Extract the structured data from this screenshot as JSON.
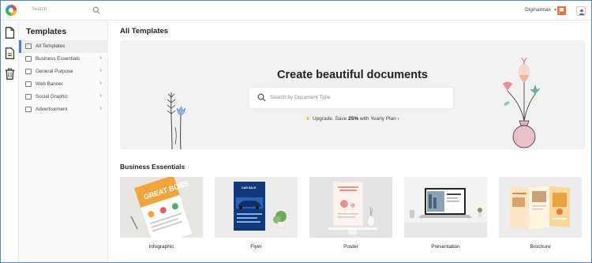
{
  "topbar": {
    "search_placeholder": "Search",
    "user_name": "Digiharmax",
    "accent": "#ee6b3b"
  },
  "rail": {
    "icons": [
      "document-icon",
      "file-text-icon",
      "trash-icon"
    ]
  },
  "sidebar": {
    "title": "Templates",
    "items": [
      {
        "label": "All Templates",
        "icon": "grid-icon",
        "active": true
      },
      {
        "label": "Business Essentials",
        "icon": "briefcase-icon"
      },
      {
        "label": "General Purpose",
        "icon": "layout-icon"
      },
      {
        "label": "Web Banner",
        "icon": "banner-icon"
      },
      {
        "label": "Social Graphic",
        "icon": "social-icon"
      },
      {
        "label": "Advertisement",
        "icon": "megaphone-icon"
      }
    ]
  },
  "main": {
    "title": "All Templates",
    "hero": {
      "title": "Create beautiful documents",
      "search_placeholder": "Search by Document Type",
      "upgrade_prefix": "Upgrade. Save ",
      "upgrade_bold": "25%",
      "upgrade_suffix": " with Yearly Plan",
      "upgrade_arrow": "›"
    },
    "section_title": "Business Essentials",
    "cards": [
      {
        "caption": "Infographic",
        "thumb_text": "GREAT BOSS"
      },
      {
        "caption": "Flyer",
        "thumb_text": "CAR SALE"
      },
      {
        "caption": "Poster"
      },
      {
        "caption": "Presentation"
      },
      {
        "caption": "Brochure"
      }
    ]
  }
}
